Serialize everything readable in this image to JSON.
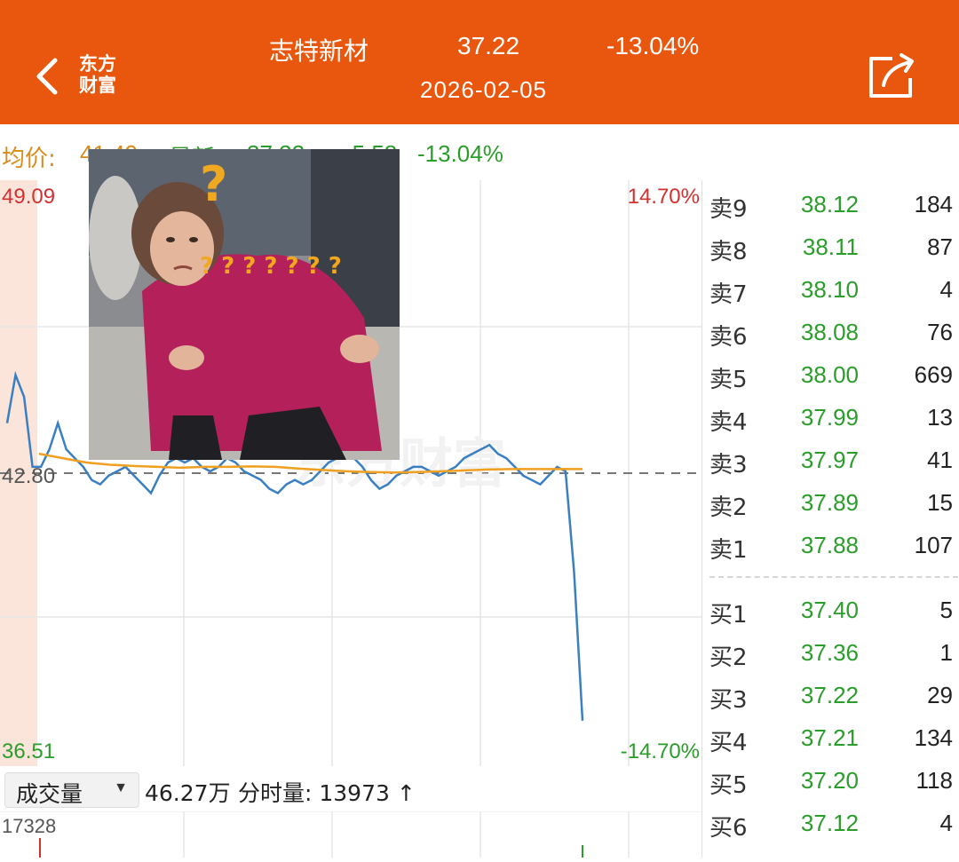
{
  "header": {
    "brand_line1": "东方",
    "brand_line2": "财富",
    "stock_name": "志特新材",
    "price": "37.22",
    "change_pct": "-13.04%",
    "date": "2026-02-05",
    "colors": {
      "bar": "#e8570d",
      "text": "#ffffff"
    },
    "icons": {
      "back": "chevron-left-icon",
      "share": "share-icon"
    }
  },
  "info": {
    "avg_label": "均价:",
    "avg_value": "41.49",
    "latest_label": "最新:",
    "latest_value": "37.22",
    "change": "-5.58",
    "change_pct": "-13.04%"
  },
  "chart": {
    "high_price": "49.09",
    "high_pct": "14.70%",
    "low_price": "36.51",
    "low_pct": "-14.70%",
    "prev_close": "42.80",
    "watermark": "东方财富"
  },
  "chart_data": {
    "type": "line",
    "ylim": [
      36.51,
      49.09
    ],
    "reference_line": 42.8,
    "series": [
      {
        "name": "price",
        "values": [
          43.7,
          44.8,
          44.3,
          42.7,
          42.7,
          43.1,
          43.7,
          43.1,
          42.9,
          42.7,
          42.4,
          42.3,
          42.5,
          42.6,
          42.7,
          42.5,
          42.3,
          42.1,
          42.5,
          42.8,
          42.9,
          42.8,
          42.9,
          42.7,
          42.6,
          42.7,
          42.9,
          42.8,
          42.6,
          42.5,
          42.4,
          42.2,
          42.1,
          42.3,
          42.4,
          42.3,
          42.4,
          42.6,
          42.8,
          42.9,
          43.0,
          42.9,
          42.7,
          42.4,
          42.2,
          42.3,
          42.5,
          42.6,
          42.7,
          42.7,
          42.6,
          42.5,
          42.6,
          42.7,
          42.9,
          43.0,
          43.1,
          43.2,
          43.0,
          42.9,
          42.7,
          42.5,
          42.4,
          42.3,
          42.5,
          42.7,
          42.6,
          40.3,
          36.9
        ]
      },
      {
        "name": "average",
        "values": [
          43.0,
          42.9,
          42.8,
          42.75,
          42.72,
          42.7,
          42.68,
          42.7,
          42.7,
          42.71,
          42.7,
          42.66,
          42.63,
          42.6,
          42.58,
          42.57,
          42.58,
          42.6,
          42.62,
          42.64,
          42.65,
          42.65,
          42.65,
          42.65
        ]
      }
    ]
  },
  "volume": {
    "selector": "成交量",
    "total": "46.27万",
    "tick_label": "分时量: 13973 ↑",
    "max": "17328"
  },
  "orderbook": {
    "asks": [
      {
        "label": "卖9",
        "price": "38.12",
        "qty": "184"
      },
      {
        "label": "卖8",
        "price": "38.11",
        "qty": "87"
      },
      {
        "label": "卖7",
        "price": "38.10",
        "qty": "4"
      },
      {
        "label": "卖6",
        "price": "38.08",
        "qty": "76"
      },
      {
        "label": "卖5",
        "price": "38.00",
        "qty": "669"
      },
      {
        "label": "卖4",
        "price": "37.99",
        "qty": "13"
      },
      {
        "label": "卖3",
        "price": "37.97",
        "qty": "41"
      },
      {
        "label": "卖2",
        "price": "37.89",
        "qty": "15"
      },
      {
        "label": "卖1",
        "price": "37.88",
        "qty": "107"
      }
    ],
    "bids": [
      {
        "label": "买1",
        "price": "37.40",
        "qty": "5"
      },
      {
        "label": "买2",
        "price": "37.36",
        "qty": "1"
      },
      {
        "label": "买3",
        "price": "37.22",
        "qty": "29"
      },
      {
        "label": "买4",
        "price": "37.21",
        "qty": "134"
      },
      {
        "label": "买5",
        "price": "37.20",
        "qty": "118"
      },
      {
        "label": "买6",
        "price": "37.12",
        "qty": "4"
      }
    ]
  },
  "meme": {
    "icon": "confused-woman-meme-image"
  }
}
